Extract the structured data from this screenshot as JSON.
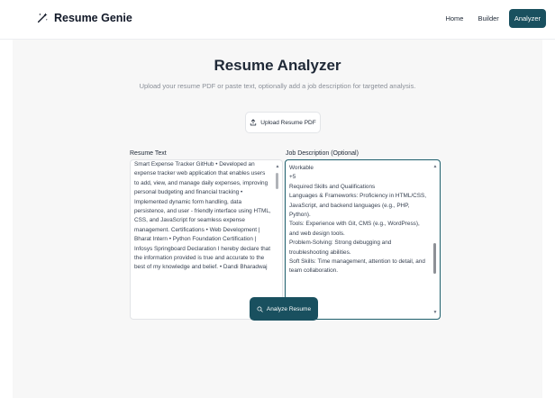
{
  "brand": {
    "name": "Resume Genie",
    "icon": "magic-wand-icon"
  },
  "nav": {
    "home": "Home",
    "builder": "Builder",
    "analyzer": "Analyzer"
  },
  "main": {
    "title": "Resume Analyzer",
    "subtitle": "Upload your resume PDF or paste text, optionally add a job description for targeted analysis.",
    "upload_label": "Upload Resume PDF",
    "resume_label": "Resume Text",
    "resume_text": "Smart Expense Tracker GitHub • Developed an expense tracker web application that enables users to add, view, and manage daily expenses, improving personal budgeting and financial tracking • Implemented dynamic form handling, data persistence, and user - friendly interface using HTML, CSS, and JavaScript for seamless expense management. Certifications • Web Development | Bharat Intern • Python Foundation Certification | Infosys Springboard Declaration I hereby declare that the information provided is true and accurate to the best of my knowledge and belief. • Dandi Bharadwaj",
    "jd_label": "Job Description (Optional)",
    "jd_text": "Workable\n+5\nRequired Skills and Qualifications\nLanguages & Frameworks: Proficiency in HTML/CSS, JavaScript, and backend languages (e.g., PHP, Python).\nTools: Experience with Git, CMS (e.g., WordPress), and web design tools.\nProblem-Solving: Strong debugging and troubleshooting abilities.\nSoft Skills: Time management, attention to detail, and team collaboration.",
    "analyze_label": "Analyze Resume"
  },
  "colors": {
    "accent": "#19505f",
    "focus_border": "#1e5f6c"
  }
}
